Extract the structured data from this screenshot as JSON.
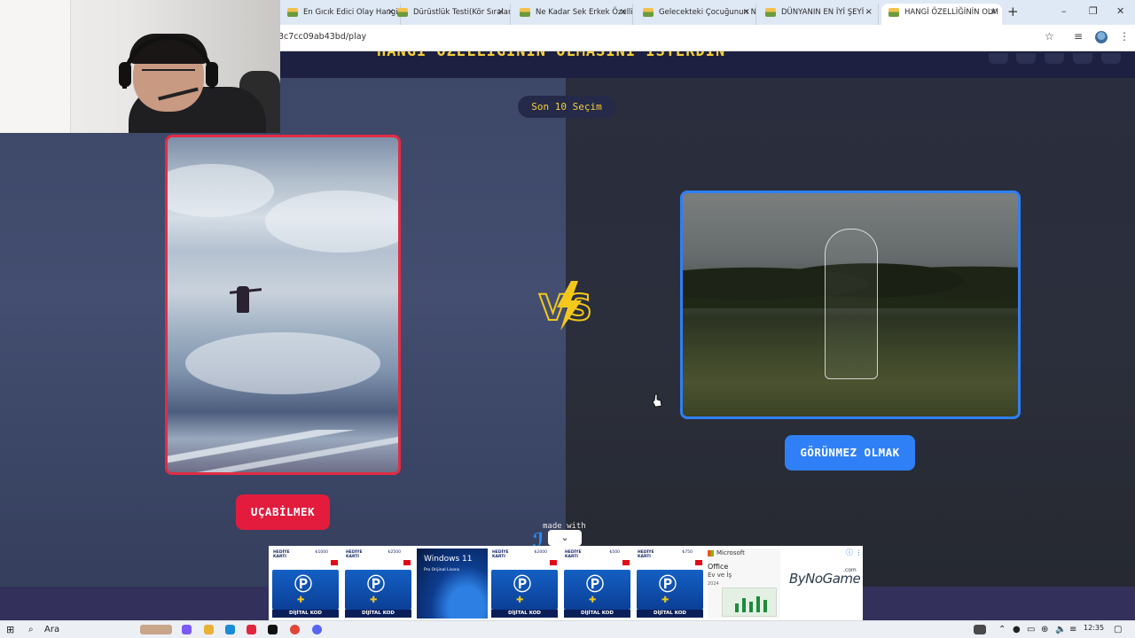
{
  "browser": {
    "tabs": [
      {
        "title": "En Gıcık Edici Olay Hangi",
        "active": false
      },
      {
        "title": "Dürüstlük Testi(Kör Sıralar",
        "active": false
      },
      {
        "title": "Ne Kadar Sek Erkek Özelli",
        "active": false
      },
      {
        "title": "Gelecekteki Çocuğunun N",
        "active": false
      },
      {
        "title": "DÜNYANIN EN İYİ ŞEYİ -",
        "active": false
      },
      {
        "title": "HANGİ ÖZELLİĞİNİN OLM",
        "active": true
      }
    ],
    "close_glyph": "×",
    "new_tab_glyph": "+",
    "url": "3c7cc09ab43bd/play",
    "window_controls": [
      "–",
      "❐",
      "✕"
    ]
  },
  "page": {
    "title": "HANGİ ÖZELLİĞİNİN OLMASINI İSTERDİN",
    "history_label": "Son 10 Seçim",
    "vs_label": "VS",
    "left_option": {
      "label": "UÇABİLMEK",
      "accent": "#e31c3d",
      "image": "person-flying-above-clouds"
    },
    "right_option": {
      "label": "GÖRÜNMEZ OLMAK",
      "accent": "#2f80f7",
      "image": "invisible-person-in-field"
    },
    "made_with": "made with",
    "collapse_glyph": "⌄"
  },
  "ad": {
    "gift_cards": [
      {
        "top": "HEDİYE KARTI",
        "price": "₺1000",
        "label": "DİJİTAL KOD"
      },
      {
        "top": "HEDİYE KARTI",
        "price": "₺2500",
        "label": "DİJİTAL KOD"
      },
      {
        "top": "HEDİYE KARTI",
        "price": "₺2000",
        "label": "DİJİTAL KOD"
      },
      {
        "top": "HEDİYE KARTI",
        "price": "₺500",
        "label": "DİJİTAL KOD"
      },
      {
        "top": "HEDİYE KARTI",
        "price": "₺750",
        "label": "DİJİTAL KOD"
      }
    ],
    "windows_title": "Windows 11",
    "windows_subtitle": "Pro Orijinal Lisans",
    "office_brand": "Microsoft",
    "office_title": "Office",
    "office_subtitle": "Ev ve İş",
    "office_year": "2024",
    "brand": "ByNoGame",
    "brand_suffix": ".com",
    "info_glyph": "ⓘ ⋮"
  },
  "taskbar": {
    "search_label": "Ara",
    "time": "12:35"
  }
}
